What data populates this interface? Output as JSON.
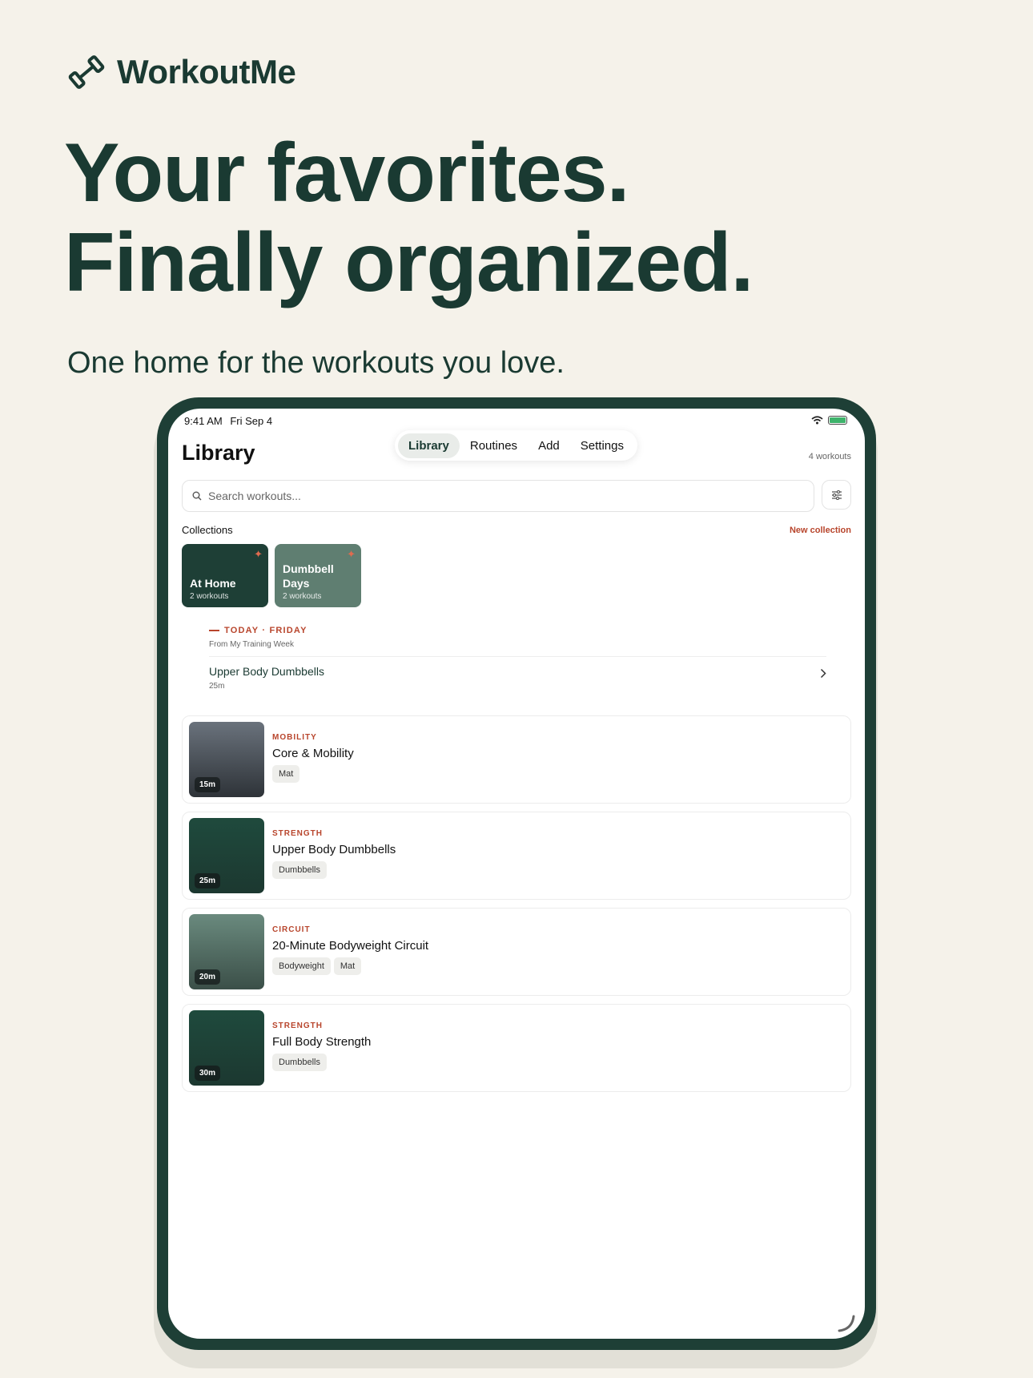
{
  "brand": {
    "name": "WorkoutMe",
    "icon": "dumbbell-icon"
  },
  "hero": {
    "headline_line1": "Your favorites.",
    "headline_line2": "Finally organized.",
    "subline": "One home for the workouts you love."
  },
  "status_bar": {
    "time": "9:41 AM",
    "date": "Fri Sep 4"
  },
  "library": {
    "title": "Library",
    "count": "4 workouts",
    "tabs": [
      {
        "label": "Library",
        "active": true
      },
      {
        "label": "Routines",
        "active": false
      },
      {
        "label": "Add",
        "active": false
      },
      {
        "label": "Settings",
        "active": false
      }
    ],
    "search_placeholder": "Search workouts...",
    "collections_label": "Collections",
    "new_collection": "New collection",
    "collections": [
      {
        "name": "At Home",
        "meta": "2 workouts",
        "color": "#1e3f36"
      },
      {
        "name": "Dumbbell Days",
        "meta": "2 workouts",
        "color": "#5f7e71"
      }
    ],
    "today": {
      "label": "TODAY · FRIDAY",
      "sub": "From My Training Week",
      "workout": "Upper Body Dumbbells",
      "duration": "25m"
    },
    "workouts": [
      {
        "category": "MOBILITY",
        "title": "Core & Mobility",
        "duration": "15m",
        "tags": [
          "Mat"
        ],
        "thumb_top": "#6a727c",
        "thumb_bottom": "#2e3338"
      },
      {
        "category": "STRENGTH",
        "title": "Upper Body Dumbbells",
        "duration": "25m",
        "tags": [
          "Dumbbells"
        ],
        "thumb_top": "#1f4a3d",
        "thumb_bottom": "#1c3830"
      },
      {
        "category": "CIRCUIT",
        "title": "20-Minute Bodyweight Circuit",
        "duration": "20m",
        "tags": [
          "Bodyweight",
          "Mat"
        ],
        "thumb_top": "#6a8a7e",
        "thumb_bottom": "#3b4f48"
      },
      {
        "category": "STRENGTH",
        "title": "Full Body Strength",
        "duration": "30m",
        "tags": [
          "Dumbbells"
        ],
        "thumb_top": "#1f4a3d",
        "thumb_bottom": "#1c3830"
      }
    ]
  },
  "colors": {
    "brand": "#1a3a32",
    "accent": "#b8452c",
    "background": "#f5f2ea"
  }
}
